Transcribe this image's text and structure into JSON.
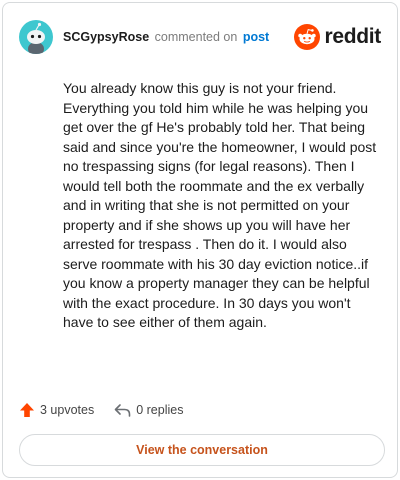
{
  "header": {
    "username": "SCGypsyRose",
    "action": "commented on",
    "post_link": "post",
    "brand": "reddit"
  },
  "comment": {
    "body": "You already know this guy is not your friend. Everything you told him while he was helping you get over the gf He's probably told her. That being said and since you're the homeowner, I would post no trespassing signs (for legal reasons). Then I would tell both the roommate and the ex verbally and in writing that she is not permitted on your property and if she shows up you will have her arrested for trespass . Then do it. I would also serve roommate with his 30 day eviction notice..if you know a property manager they can be helpful with the exact procedure. In 30 days you won't have to see either of them again."
  },
  "actions": {
    "upvotes": "3 upvotes",
    "replies": "0 replies"
  },
  "cta": {
    "label": "View the conversation"
  },
  "icons": {
    "avatar": "snoo-avatar-icon",
    "brand_logo": "reddit-logo-icon",
    "upvote": "upvote-arrow-icon",
    "reply": "reply-arrow-icon"
  },
  "colors": {
    "avatar_bg": "#3ec7cf",
    "reddit_orange": "#ff4500",
    "link_blue": "#0079d3",
    "cta_text": "#c6531c",
    "border": "#d7dadc"
  }
}
